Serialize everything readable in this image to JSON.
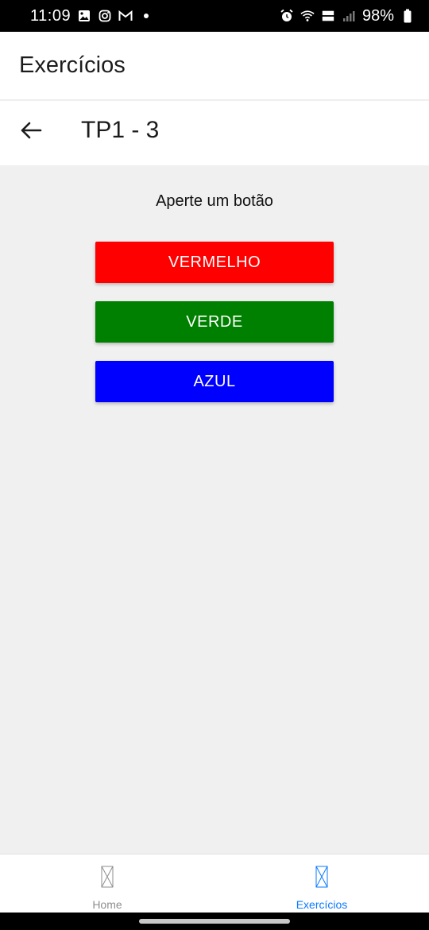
{
  "status_bar": {
    "time": "11:09",
    "battery": "98%",
    "left_icons": [
      "gallery-icon",
      "instagram-icon",
      "gmail-icon",
      "notification-dot-icon"
    ],
    "right_icons": [
      "alarm-icon",
      "wifi-icon",
      "volte-icon",
      "signal-icon",
      "battery-icon"
    ]
  },
  "app_header": {
    "title": "Exercícios"
  },
  "screen_header": {
    "title": "TP1 - 3",
    "back_icon": "arrow-left-icon"
  },
  "main": {
    "prompt": "Aperte um botão",
    "buttons": [
      {
        "label": "VERMELHO",
        "color": "#ff0000"
      },
      {
        "label": "VERDE",
        "color": "#008000"
      },
      {
        "label": "AZUL",
        "color": "#0000ff"
      }
    ]
  },
  "tab_bar": {
    "tabs": [
      {
        "label": "Home",
        "icon": "missing-image-icon",
        "active": false,
        "color": "#8e8e8f"
      },
      {
        "label": "Exercícios",
        "icon": "missing-image-icon",
        "active": true,
        "color": "#0a7aff"
      }
    ]
  }
}
